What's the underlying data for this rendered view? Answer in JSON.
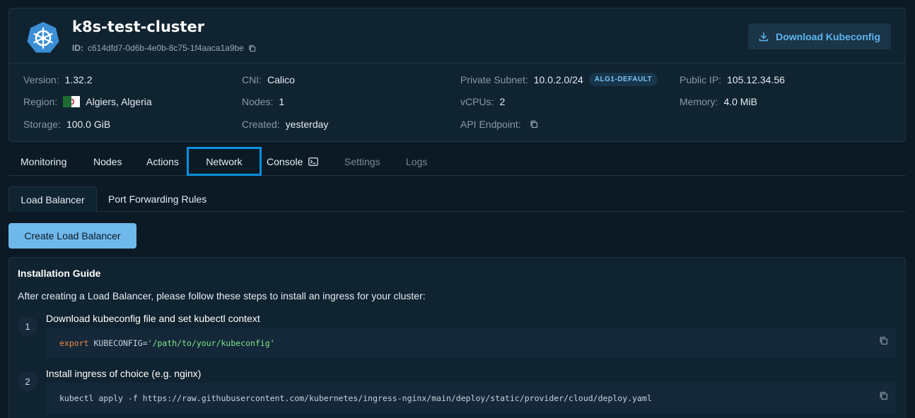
{
  "header": {
    "cluster_name": "k8s-test-cluster",
    "id_label": "ID:",
    "id_value": "c614dfd7-0d6b-4e0b-8c75-1f4aaca1a9be",
    "download_label": "Download Kubeconfig"
  },
  "info": {
    "version_label": "Version:",
    "version_value": "1.32.2",
    "region_label": "Region:",
    "region_value": "Algiers, Algeria",
    "storage_label": "Storage:",
    "storage_value": "100.0 GiB",
    "cni_label": "CNI:",
    "cni_value": "Calico",
    "nodes_label": "Nodes:",
    "nodes_value": "1",
    "created_label": "Created:",
    "created_value": "yesterday",
    "subnet_label": "Private Subnet:",
    "subnet_value": "10.0.2.0/24",
    "subnet_badge": "ALG1-DEFAULT",
    "vcpus_label": "vCPUs:",
    "vcpus_value": "2",
    "api_label": "API Endpoint:",
    "publicip_label": "Public IP:",
    "publicip_value": "105.12.34.56",
    "memory_label": "Memory:",
    "memory_value": "4.0 MiB"
  },
  "tabs": {
    "monitoring": "Monitoring",
    "nodes": "Nodes",
    "actions": "Actions",
    "network": "Network",
    "console": "Console",
    "settings": "Settings",
    "logs": "Logs"
  },
  "subtabs": {
    "load_balancer": "Load Balancer",
    "port_forwarding": "Port Forwarding Rules"
  },
  "create_button": "Create Load Balancer",
  "guide": {
    "title": "Installation Guide",
    "intro": "After creating a Load Balancer, please follow these steps to install an ingress for your cluster:",
    "steps": [
      {
        "number": "1",
        "title": "Download kubeconfig file and set kubectl context",
        "code_keyword": "export",
        "code_plain": " KUBECONFIG=",
        "code_string": "'/path/to/your/kubeconfig'"
      },
      {
        "number": "2",
        "title": "Install ingress of choice (e.g. nginx)",
        "code_plain": "kubectl apply -f https://raw.githubusercontent.com/kubernetes/ingress-nginx/main/deploy/static/provider/cloud/deploy.yaml"
      }
    ]
  },
  "colors": {
    "background": "#0b1a24",
    "card": "#102330",
    "accent": "#0a8fe0",
    "primary_button": "#6fb8ec",
    "link_blue": "#5eb4f0"
  },
  "icons": [
    "kubernetes-helm-icon",
    "copy-icon",
    "download-icon",
    "terminal-icon",
    "algeria-flag-icon"
  ]
}
